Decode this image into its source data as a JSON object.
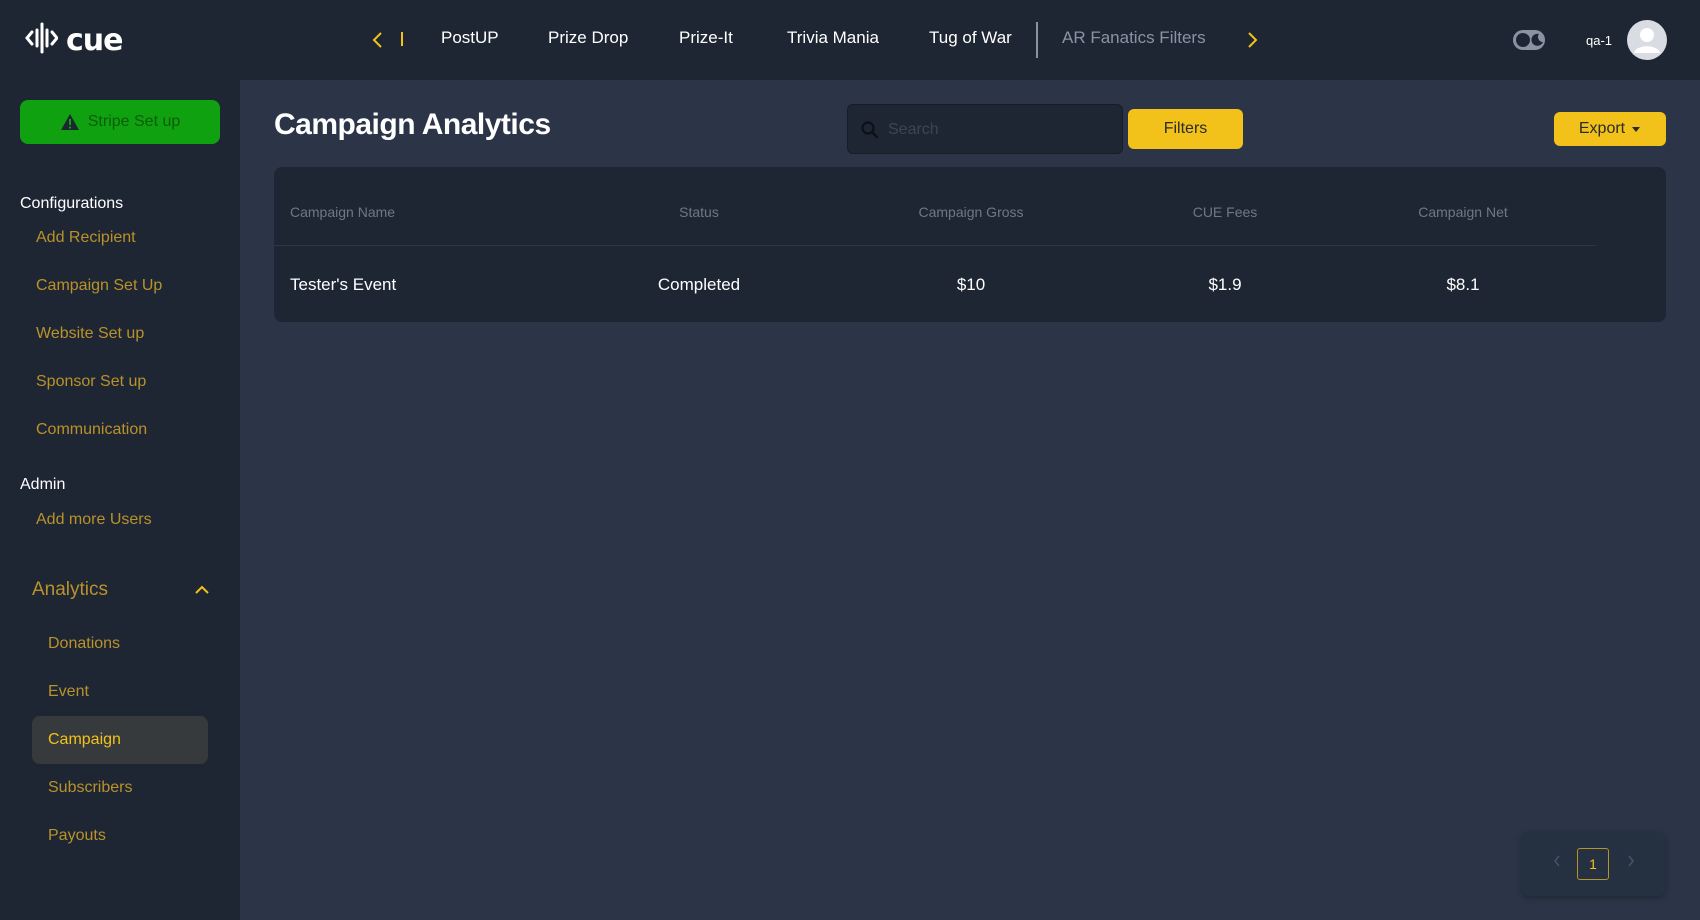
{
  "header": {
    "logo_text": "cue",
    "tabs": [
      {
        "label": "PostUP"
      },
      {
        "label": "Prize Drop"
      },
      {
        "label": "Prize-It"
      },
      {
        "label": "Trivia Mania"
      },
      {
        "label": "Tug of War"
      },
      {
        "label": "AR Fanatics Filters"
      }
    ],
    "username": "qa-1"
  },
  "sidebar": {
    "stripe_button": "Stripe Set up",
    "configurations_heading": "Configurations",
    "configurations": [
      {
        "label": "Add Recipient"
      },
      {
        "label": "Campaign Set Up"
      },
      {
        "label": "Website Set up"
      },
      {
        "label": "Sponsor Set up"
      },
      {
        "label": "Communication"
      }
    ],
    "admin_heading": "Admin",
    "admin": [
      {
        "label": "Add more Users"
      }
    ],
    "analytics_label": "Analytics",
    "analytics": [
      {
        "label": "Donations"
      },
      {
        "label": "Event"
      },
      {
        "label": "Campaign"
      },
      {
        "label": "Subscribers"
      },
      {
        "label": "Payouts"
      }
    ]
  },
  "main": {
    "title": "Campaign Analytics",
    "search_placeholder": "Search",
    "filters_label": "Filters",
    "export_label": "Export",
    "table": {
      "columns": [
        "Campaign Name",
        "Status",
        "Campaign Gross",
        "CUE Fees",
        "Campaign Net"
      ],
      "rows": [
        [
          "Tester's Event",
          "Completed",
          "$10",
          "$1.9",
          "$8.1"
        ]
      ]
    },
    "pagination": {
      "current_page": "1"
    }
  },
  "colors": {
    "accent": "#f2c21a",
    "sidebar_link": "#b8922a",
    "stripe_green": "#0fa10f",
    "background": "#1f2633",
    "panel": "#2b3547"
  }
}
